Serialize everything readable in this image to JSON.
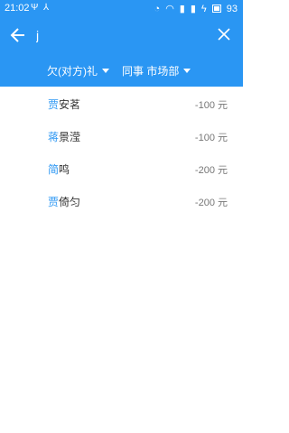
{
  "status_bar": {
    "time": "21:02",
    "battery": "93",
    "left_icons": [
      "usb-icon",
      "share-icon"
    ],
    "right_icons": [
      "alarm-icon",
      "wifi-icon",
      "signal-icon",
      "signal-icon",
      "charging-icon",
      "battery-icon"
    ]
  },
  "search": {
    "value": "j",
    "placeholder": ""
  },
  "filters": [
    {
      "label": "欠(对方)礼"
    },
    {
      "label": "同事 市场部"
    }
  ],
  "results": [
    {
      "initial": "贾",
      "rest": "安茗",
      "amount": "-100 元"
    },
    {
      "initial": "蒋",
      "rest": "景滢",
      "amount": "-100 元"
    },
    {
      "initial": "简",
      "rest": "鸣",
      "amount": "-200 元"
    },
    {
      "initial": "贾",
      "rest": "倚匀",
      "amount": "-200 元"
    }
  ],
  "colors": {
    "primary": "#2a96f3",
    "amount": "#777777"
  }
}
